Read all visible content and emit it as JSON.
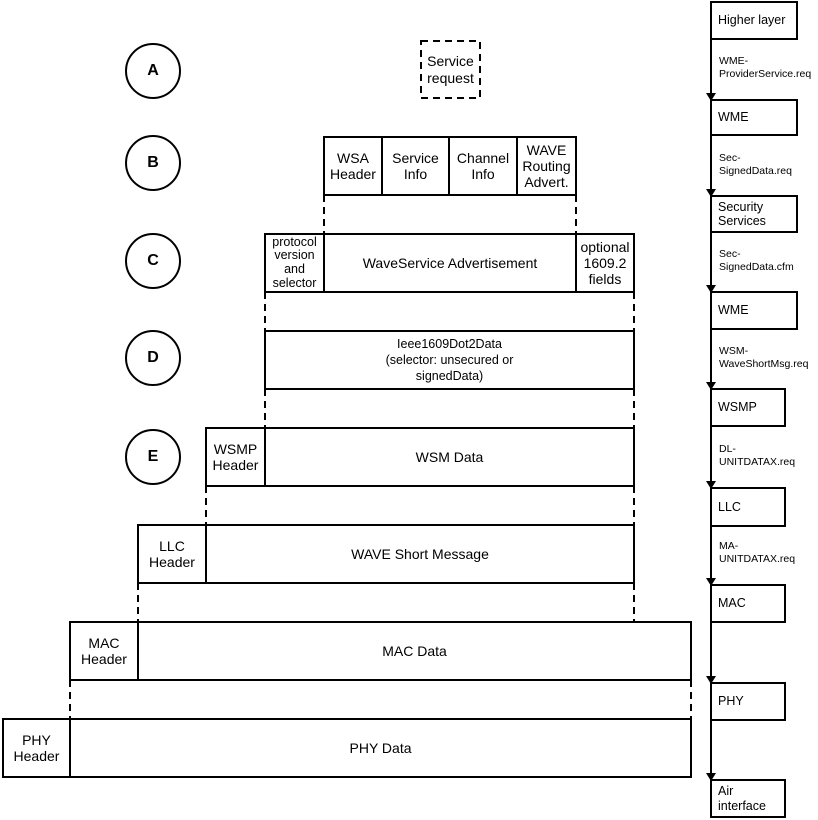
{
  "stages": [
    {
      "id": "A",
      "label": "A"
    },
    {
      "id": "B",
      "label": "B"
    },
    {
      "id": "C",
      "label": "C"
    },
    {
      "id": "D",
      "label": "D"
    },
    {
      "id": "E",
      "label": "E"
    }
  ],
  "rows": {
    "a": {
      "service_request": "Service\nrequest"
    },
    "b": {
      "wsa_header": "WSA\nHeader",
      "service_info": "Service\nInfo",
      "channel_info": "Channel\nInfo",
      "wave_routing": "WAVE\nRouting\nAdvert."
    },
    "c": {
      "protocol": "protocol\nversion\nand\nselector",
      "wsa": "WaveService Advertisement",
      "optional": "optional\n1609.2\nfields"
    },
    "d": {
      "ieee": "Ieee1609Dot2Data\n(selector: unsecured or\nsignedData)"
    },
    "e": {
      "wsmp_header": "WSMP\nHeader",
      "wsm_data": "WSM Data"
    },
    "llc": {
      "header": "LLC\nHeader",
      "data": "WAVE Short Message"
    },
    "mac": {
      "header": "MAC\nHeader",
      "data": "MAC Data"
    },
    "phy": {
      "header": "PHY\nHeader",
      "data": "PHY Data"
    }
  },
  "stack": {
    "layers": [
      "Higher layer",
      "WME",
      "Security\nServices",
      "WME",
      "WSMP",
      "LLC",
      "MAC",
      "PHY",
      "Air\ninterface"
    ],
    "primitives": [
      "WME-\nProviderService.req",
      "Sec-\nSignedData.req",
      "Sec-\nSignedData.cfm",
      "WSM-\nWaveShortMsg.req",
      "DL-\nUNITDATAX.req",
      "MA-\nUNITDATAX.req"
    ]
  }
}
